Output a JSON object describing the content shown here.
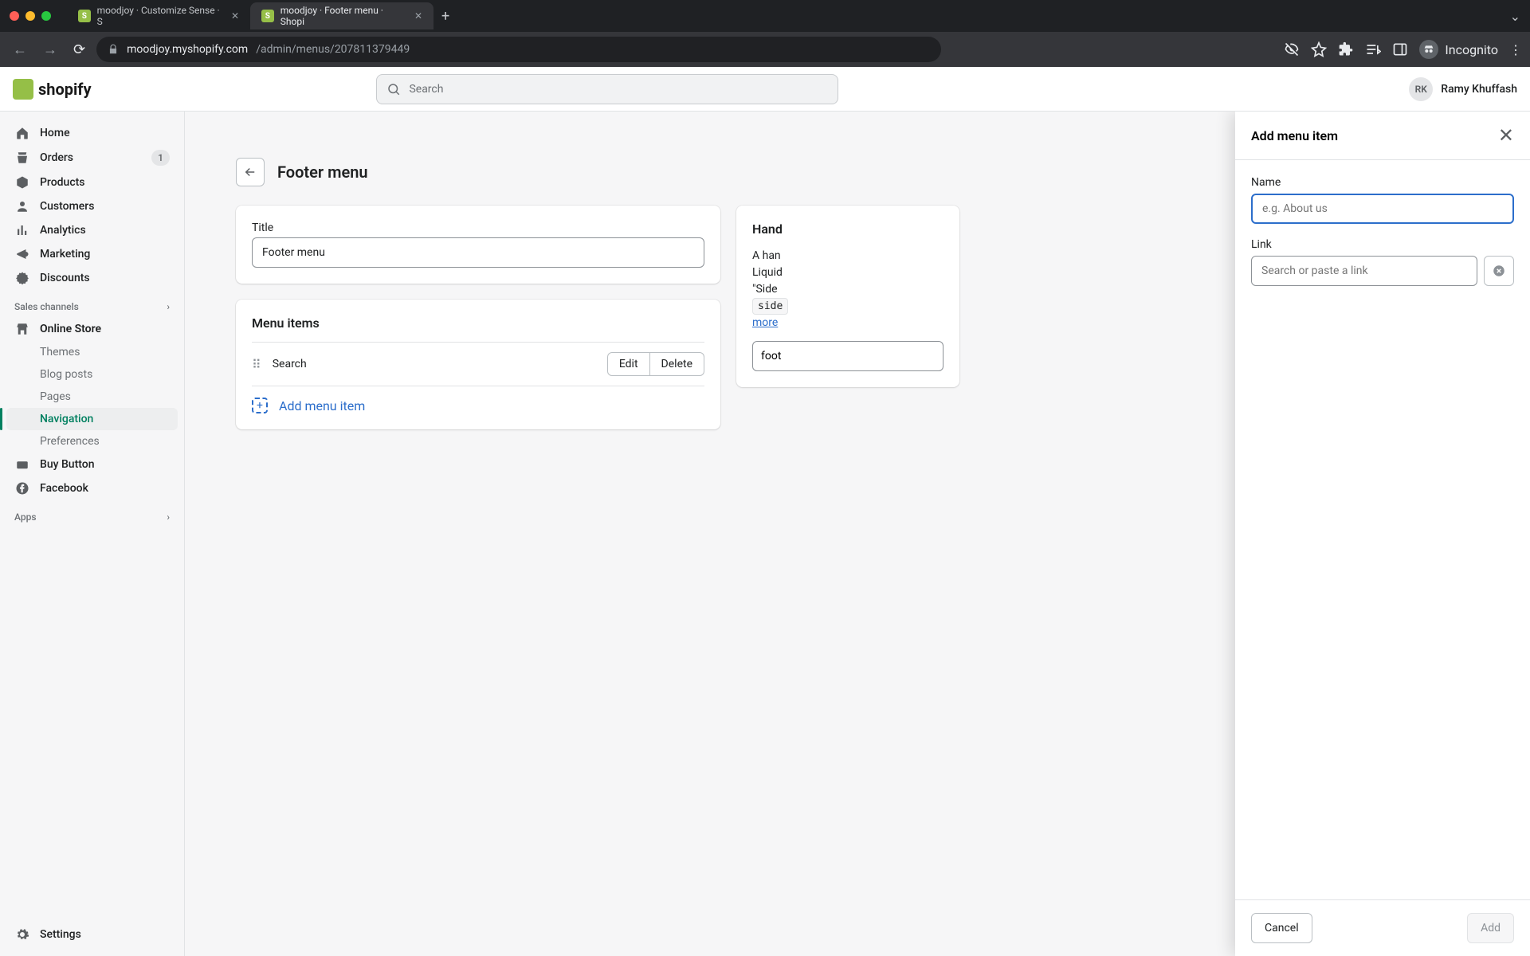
{
  "browser": {
    "tabs": [
      {
        "favicon": "S",
        "title": "moodjoy · Customize Sense · S"
      },
      {
        "favicon": "S",
        "title": "moodjoy · Footer menu · Shopi"
      }
    ],
    "url_host": "moodjoy.myshopify.com",
    "url_path": "/admin/menus/207811379449",
    "incognito_label": "Incognito"
  },
  "header": {
    "logo_text": "shopify",
    "search_placeholder": "Search",
    "user_initials": "RK",
    "user_name": "Ramy Khuffash"
  },
  "sidebar": {
    "items": [
      {
        "icon": "home",
        "label": "Home"
      },
      {
        "icon": "orders",
        "label": "Orders",
        "badge": "1"
      },
      {
        "icon": "products",
        "label": "Products"
      },
      {
        "icon": "customers",
        "label": "Customers"
      },
      {
        "icon": "analytics",
        "label": "Analytics"
      },
      {
        "icon": "marketing",
        "label": "Marketing"
      },
      {
        "icon": "discounts",
        "label": "Discounts"
      }
    ],
    "channels_label": "Sales channels",
    "channels": [
      {
        "icon": "store",
        "label": "Online Store",
        "sub": [
          {
            "label": "Themes"
          },
          {
            "label": "Blog posts"
          },
          {
            "label": "Pages"
          },
          {
            "label": "Navigation",
            "active": true
          },
          {
            "label": "Preferences"
          }
        ]
      },
      {
        "icon": "buy",
        "label": "Buy Button"
      },
      {
        "icon": "facebook",
        "label": "Facebook"
      }
    ],
    "apps_label": "Apps",
    "settings_label": "Settings"
  },
  "main": {
    "page_title": "Footer menu",
    "title_card": {
      "label": "Title",
      "value": "Footer menu"
    },
    "menu_items_card": {
      "heading": "Menu items",
      "rows": [
        {
          "label": "Search",
          "edit": "Edit",
          "delete": "Delete"
        }
      ],
      "add_label": "Add menu item"
    },
    "handle_card": {
      "heading": "Hand",
      "body_prefix": "A han",
      "body_liquid": "Liquid",
      "body_side": "\"Side",
      "code": "side",
      "more": "more",
      "tag": "foot"
    }
  },
  "drawer": {
    "title": "Add menu item",
    "name_label": "Name",
    "name_placeholder": "e.g. About us",
    "name_value": "",
    "link_label": "Link",
    "link_placeholder": "Search or paste a link",
    "cancel": "Cancel",
    "add": "Add"
  }
}
